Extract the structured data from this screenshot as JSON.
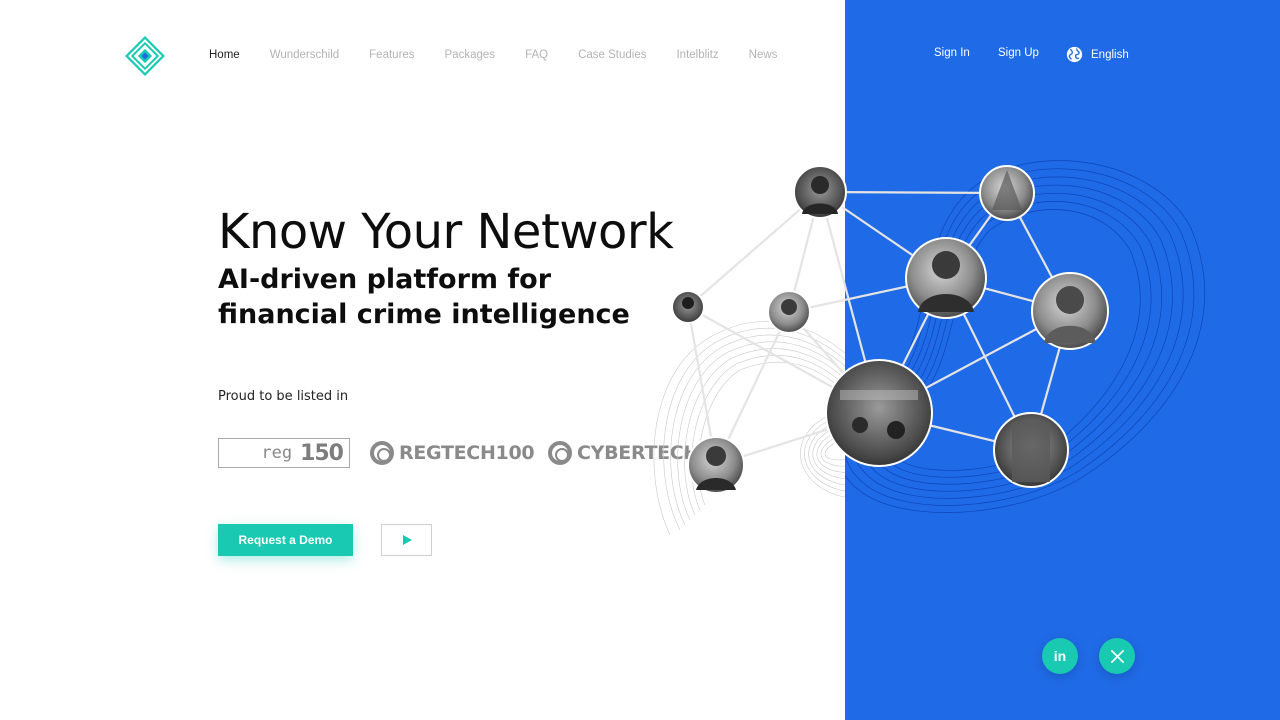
{
  "nav": {
    "items": [
      {
        "label": "Home",
        "active": true
      },
      {
        "label": "Wunderschild",
        "active": false
      },
      {
        "label": "Features",
        "active": false
      },
      {
        "label": "Packages",
        "active": false
      },
      {
        "label": "FAQ",
        "active": false
      },
      {
        "label": "Case Studies",
        "active": false
      },
      {
        "label": "Intelblitz",
        "active": false
      },
      {
        "label": "News",
        "active": false
      }
    ],
    "sign_in": "Sign In",
    "sign_up": "Sign Up",
    "language": "English"
  },
  "hero": {
    "title": "Know Your Network",
    "subtitle": "AI-driven platform for financial crime intelligence",
    "listed_label": "Proud to be listed in",
    "partners": {
      "reg_text": "reg",
      "reg_number": "150",
      "regtech": "REGTECH100",
      "cybertech": "CYBERTECH"
    },
    "demo_button": "Request a Demo",
    "play_icon": "play-icon"
  },
  "social": {
    "linkedin_text": "in",
    "linkedin_icon": "linkedin-icon",
    "x_icon": "x-icon"
  },
  "colors": {
    "accent": "#19c9b1",
    "panel_blue": "#1f6ae6",
    "nav_inactive": "#b3b3b3",
    "nav_active": "#222222"
  }
}
